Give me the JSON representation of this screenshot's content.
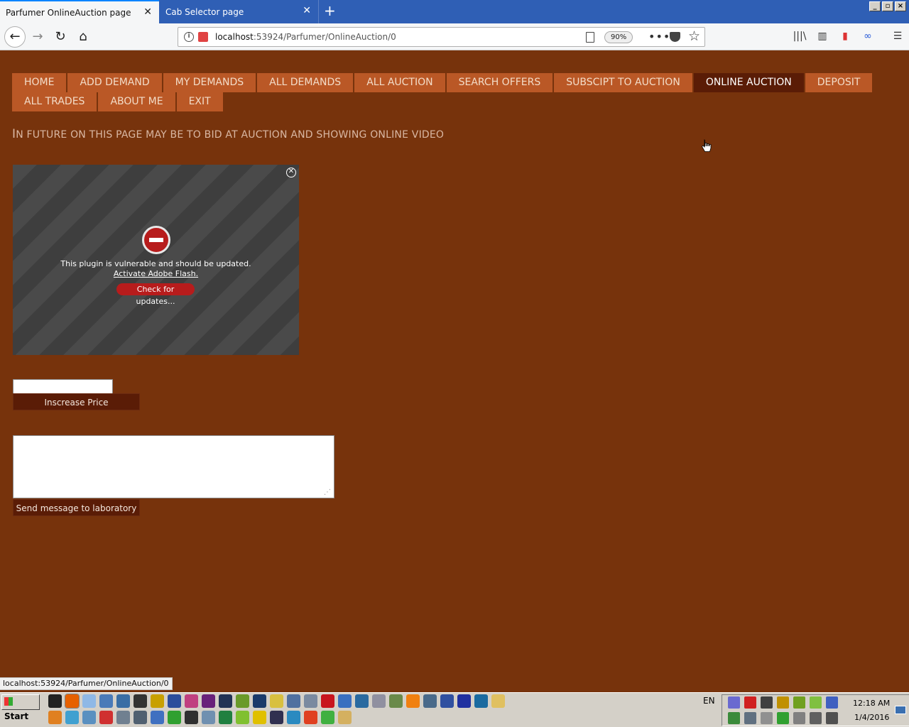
{
  "browser": {
    "tabs": [
      {
        "label": "Parfumer OnlineAuction page",
        "active": true
      },
      {
        "label": "Cab Selector page",
        "active": false
      }
    ],
    "new_tab_symbol": "+",
    "url_host": "localhost",
    "url_rest": ":53924/Parfumer/OnlineAuction/0",
    "zoom": "90%",
    "window_buttons": [
      "_",
      "▫",
      "×"
    ]
  },
  "menu": {
    "row1": [
      "HOME",
      "ADD DEMAND",
      "MY DEMANDS",
      "ALL DEMANDS",
      "ALL AUCTION",
      "SEARCH OFFERS",
      "SUBSCIPT TO AUCTION",
      "ONLINE AUCTION",
      "DEPOSIT"
    ],
    "row2": [
      "ALL TRADES",
      "ABOUT ME",
      "EXIT"
    ],
    "active": "ONLINE AUCTION"
  },
  "page": {
    "heading_first": "I",
    "heading_rest": "N FUTURE ON THIS PAGE MAY BE TO BID AT AUCTION AND SHOWING ONLINE VIDEO",
    "plugin_message": "This plugin is vulnerable and should be updated.",
    "plugin_link": "Activate Adobe Flash.",
    "plugin_button": "Check for updates...",
    "price_value": "",
    "price_button": "Inscrease Price",
    "message_value": "",
    "message_button": "Send message to laboratory"
  },
  "status_bar": "localhost:53924/Parfumer/OnlineAuction/0",
  "taskbar": {
    "start_label": "Start",
    "language": "EN",
    "time": "12:18 AM",
    "date": "1/4/2016",
    "row1_colors": [
      "#222222",
      "#e66000",
      "#8fb8e6",
      "#4a7ab8",
      "#3a6ea5",
      "#333333",
      "#c8a000",
      "#2b4d9c",
      "#c04080",
      "#68217a",
      "#223355",
      "#6a9a2a",
      "#1a3a6a",
      "#d8c040",
      "#5070a0",
      "#7a8aa0",
      "#c8141e",
      "#3a70c0",
      "#2a6aa0",
      "#9090a0",
      "#6a8a4a",
      "#f08010",
      "#4a6a8a",
      "#3050a0",
      "#2030a0",
      "#1a6aa0",
      "#e0c060"
    ],
    "row2_colors": [
      "#e08020",
      "#40a0d0",
      "#5a90c0",
      "#d03030",
      "#708090",
      "#506070",
      "#4070c0",
      "#30a030",
      "#303030",
      "#7090b0",
      "#208040",
      "#80c030",
      "#e0c000",
      "#303050",
      "#2a8ac0",
      "#e04020",
      "#40b040",
      "#d4b060"
    ],
    "tray_row1_colors": [
      "#6a6ad0",
      "#d02020",
      "#404040",
      "#c09000",
      "#70a020",
      "#80c040",
      "#4060c0"
    ],
    "tray_row2_colors": [
      "#3a8a3a",
      "#607080",
      "#909090",
      "#30a030",
      "#808080",
      "#606060",
      "#505050"
    ]
  }
}
